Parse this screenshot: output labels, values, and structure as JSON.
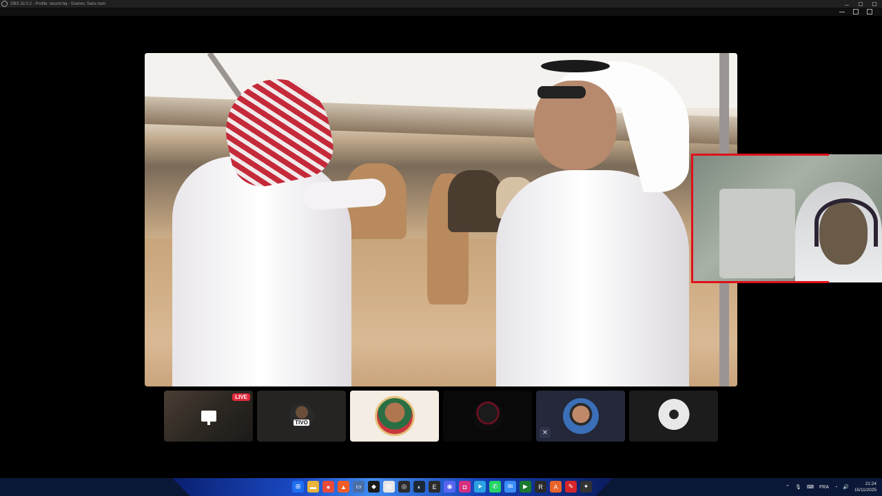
{
  "window": {
    "title": "OBS 32.0.2 - Profile: record-hq - Scenes: Sans nom"
  },
  "main_video": {
    "description_icon": "video-feed"
  },
  "tiles": [
    {
      "kind": "screen-share",
      "badge": "LIVE",
      "icon": "screenshare-icon"
    },
    {
      "kind": "avatar",
      "label": "TIVO",
      "icon": "avatar-tivo"
    },
    {
      "kind": "avatar",
      "icon": "avatar-active-speaker",
      "active": true
    },
    {
      "kind": "avatar",
      "icon": "avatar-dark"
    },
    {
      "kind": "avatar",
      "icon": "avatar-glasses",
      "muted": true,
      "mute_icon": "microphone-muted-icon"
    },
    {
      "kind": "avatar",
      "icon": "avatar-skull"
    }
  ],
  "taskbar": {
    "apps": [
      {
        "name": "windows-start-icon",
        "color": "#1e6ff2",
        "glyph": "⊞"
      },
      {
        "name": "file-explorer-icon",
        "color": "#e8b43a",
        "glyph": "▬"
      },
      {
        "name": "chrome-icon",
        "color": "#e84b3a",
        "glyph": "●"
      },
      {
        "name": "brave-icon",
        "color": "#f25c26",
        "glyph": "▲"
      },
      {
        "name": "desktop-icon",
        "color": "#4a6ea8",
        "glyph": "▭"
      },
      {
        "name": "capcut-icon",
        "color": "#1b1b1b",
        "glyph": "◆"
      },
      {
        "name": "notepad-icon",
        "color": "#e6e6e6",
        "glyph": "▤"
      },
      {
        "name": "obs-icon",
        "color": "#2a2a2a",
        "glyph": "◎"
      },
      {
        "name": "steam-icon",
        "color": "#1b2838",
        "glyph": "◐"
      },
      {
        "name": "epic-icon",
        "color": "#2b2b2b",
        "glyph": "E"
      },
      {
        "name": "discord-icon",
        "color": "#5865f2",
        "glyph": "◉"
      },
      {
        "name": "instagram-icon",
        "color": "#d6307f",
        "glyph": "◘"
      },
      {
        "name": "telegram-icon",
        "color": "#2aa3e0",
        "glyph": "➤"
      },
      {
        "name": "whatsapp-icon",
        "color": "#25d366",
        "glyph": "✆"
      },
      {
        "name": "messenger-icon",
        "color": "#3a8ef6",
        "glyph": "✉"
      },
      {
        "name": "gamepass-icon",
        "color": "#1b7a2f",
        "glyph": "▶"
      },
      {
        "name": "roblox-icon",
        "color": "#2b2b2b",
        "glyph": "R"
      },
      {
        "name": "office-icon",
        "color": "#e8632a",
        "glyph": "A"
      },
      {
        "name": "acrobat-icon",
        "color": "#d6252a",
        "glyph": "✎"
      },
      {
        "name": "game-launcher-icon",
        "color": "#333333",
        "glyph": "✦"
      }
    ],
    "tray": {
      "language": "FRA",
      "time": "21:24",
      "date": "15/11/2025"
    }
  }
}
